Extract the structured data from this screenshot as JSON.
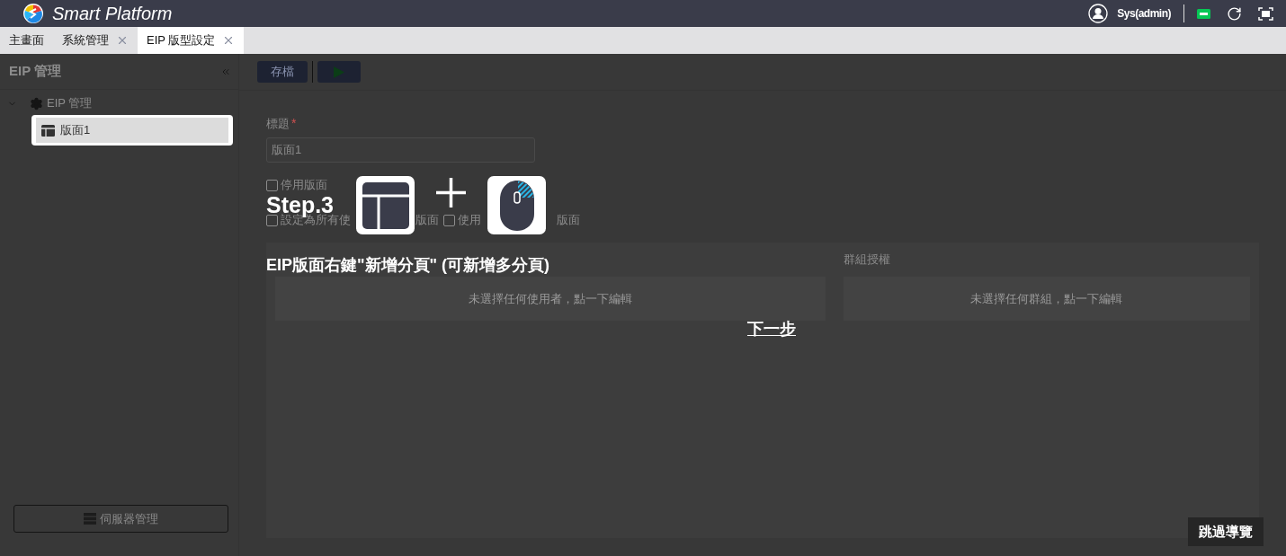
{
  "app": {
    "title": "Smart Platform",
    "user": "Sys(admin)"
  },
  "tabs": [
    {
      "label": "主畫面",
      "closable": false,
      "selected": false
    },
    {
      "label": "系統管理",
      "closable": true,
      "selected": false
    },
    {
      "label": "EIP 版型設定",
      "closable": true,
      "selected": true
    }
  ],
  "sidebar": {
    "title": "EIP 管理",
    "tree": [
      {
        "label": "EIP 管理",
        "expanded": true,
        "children": [
          {
            "label": "版面1",
            "selected": true
          }
        ]
      }
    ],
    "footer_button": "伺服器管理"
  },
  "toolbar": {
    "buttons": [
      {
        "kind": "text",
        "label": "存檔"
      },
      {
        "kind": "play"
      }
    ]
  },
  "form": {
    "title_label": "標題",
    "required_mark": "*",
    "title_value": "版面1",
    "checkboxes": [
      {
        "label": "停用版面",
        "checked": false
      }
    ],
    "row_checkboxes": [
      {
        "label": "設定為所有使",
        "tail": "版面",
        "checked": false
      },
      {
        "label": "使用",
        "tail": "版面",
        "checked": false
      }
    ]
  },
  "permissions": [
    {
      "empty_text": "未選擇任何使用者，點一下編輯"
    },
    {
      "heading": "群組授權",
      "empty_text": "未選擇任何群組，點一下編輯"
    }
  ],
  "tour": {
    "step": "Step.3",
    "caption": "EIP版面右鍵\"新增分頁\" (可新增多分頁)",
    "next": "下一步",
    "skip": "跳過導覽"
  }
}
